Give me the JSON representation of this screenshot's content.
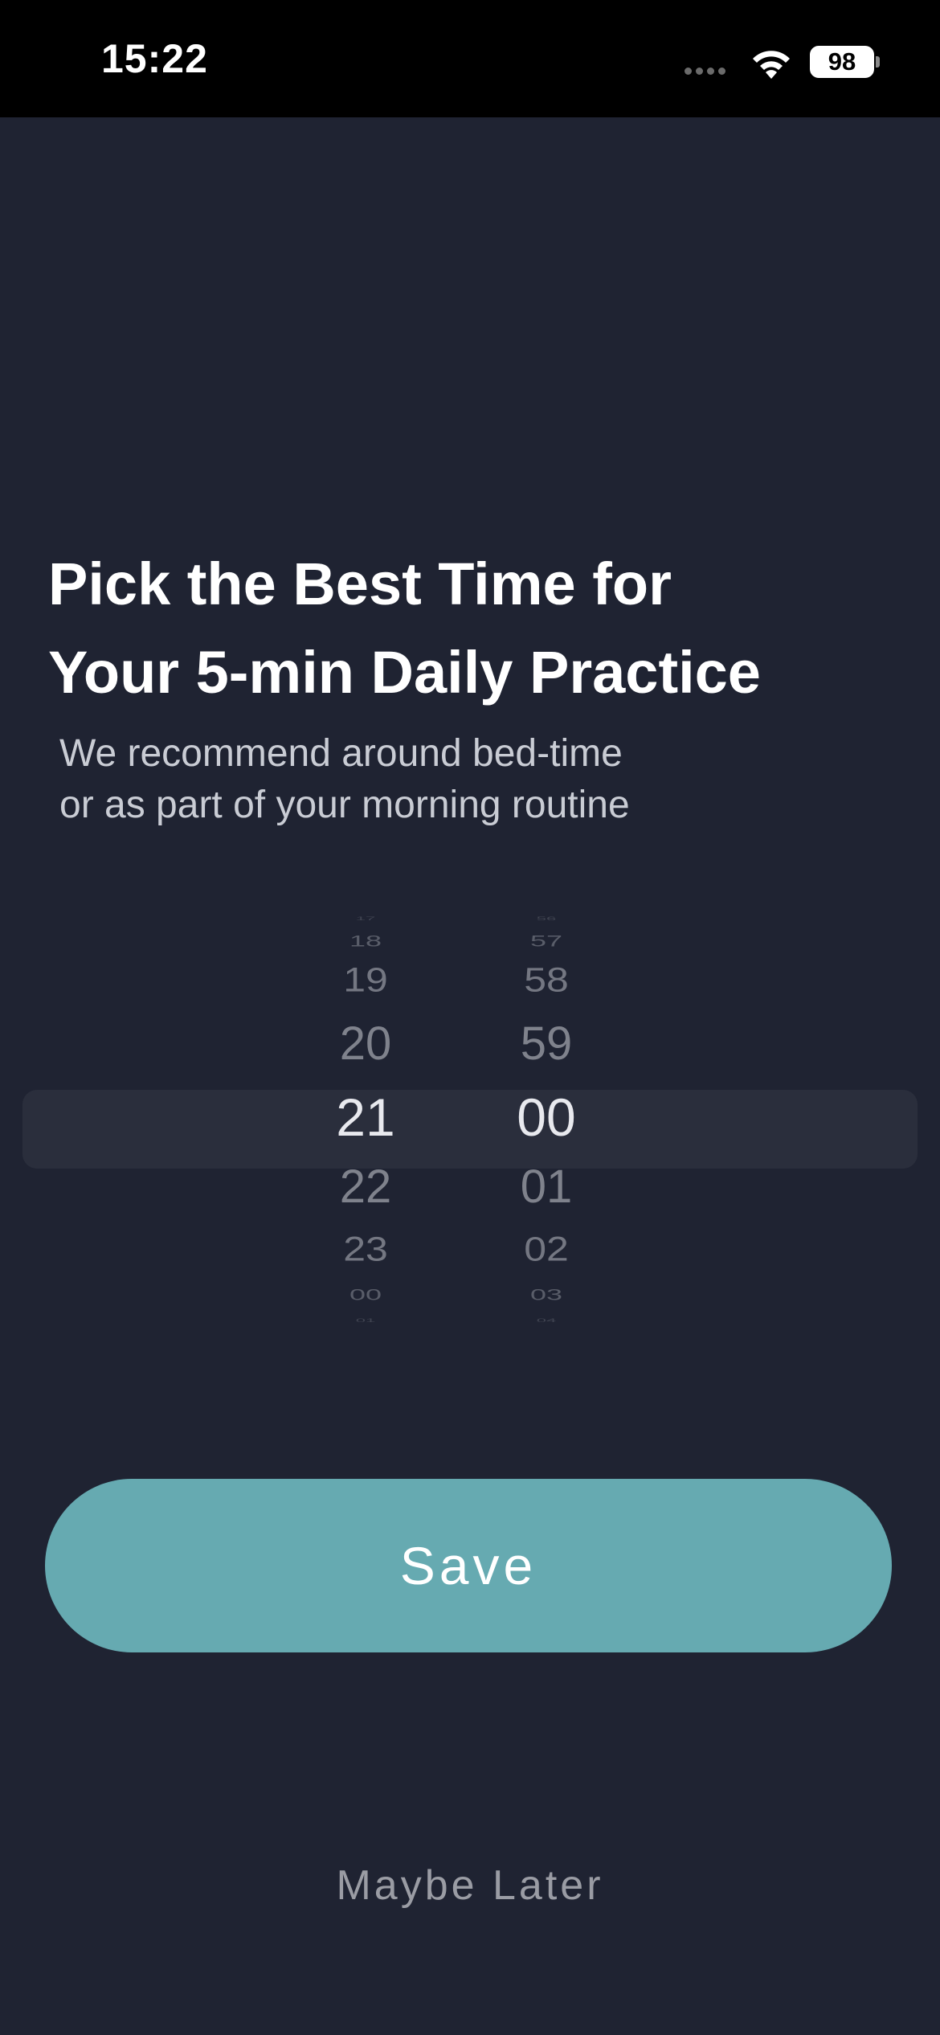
{
  "status_bar": {
    "time": "15:22",
    "battery": "98"
  },
  "header": {
    "title_line1": "Pick the Best Time for",
    "title_line2": "Your 5-min Daily Practice",
    "subtitle_line1": "We recommend around bed-time",
    "subtitle_line2": "or as part of your morning routine"
  },
  "picker": {
    "hours": [
      "17",
      "18",
      "19",
      "20",
      "21",
      "22",
      "23",
      "00",
      "01"
    ],
    "minutes": [
      "56",
      "57",
      "58",
      "59",
      "00",
      "01",
      "02",
      "03",
      "04"
    ],
    "selected_hour": "21",
    "selected_minute": "00"
  },
  "actions": {
    "save_label": "Save",
    "maybe_later_label": "Maybe Later"
  },
  "colors": {
    "background": "#1f2332",
    "accent": "#66aab1",
    "highlight_row": "#2a2e3c"
  },
  "icons": {
    "signal": "cellular-signal-icon",
    "wifi": "wifi-icon",
    "battery": "battery-icon"
  }
}
